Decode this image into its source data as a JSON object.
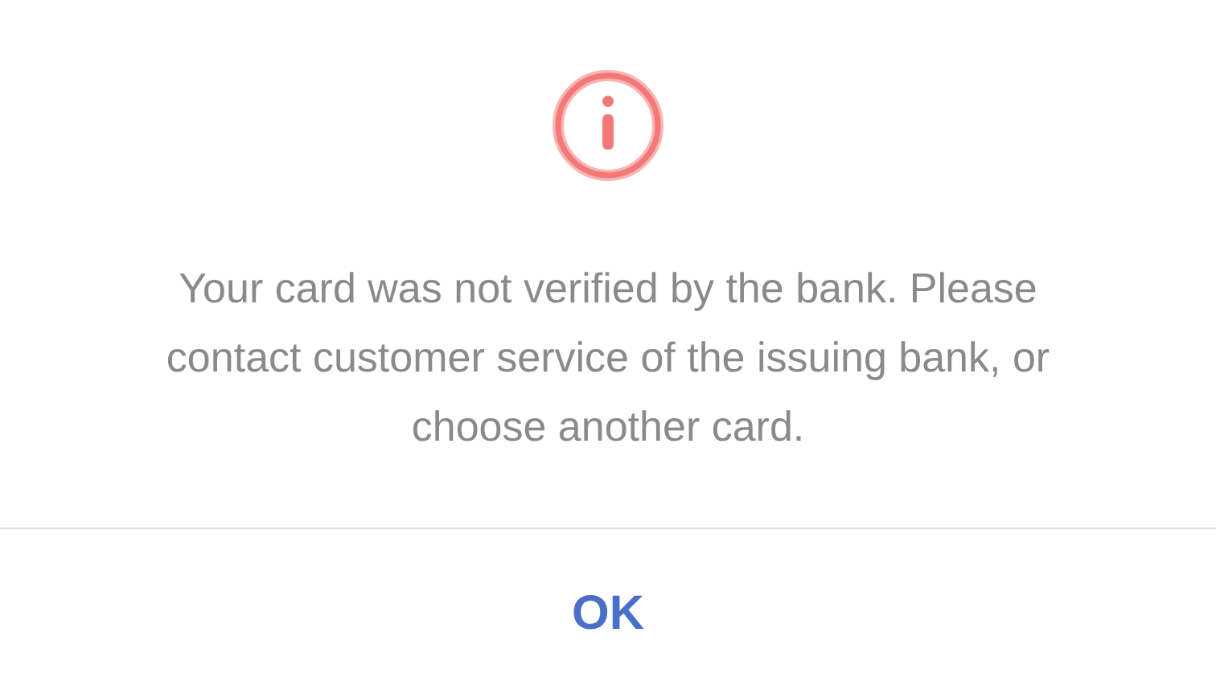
{
  "message": "Your card was not verified by the bank. Please contact customer service of the issuing bank, or choose another card.",
  "buttons": [
    "OK"
  ]
}
